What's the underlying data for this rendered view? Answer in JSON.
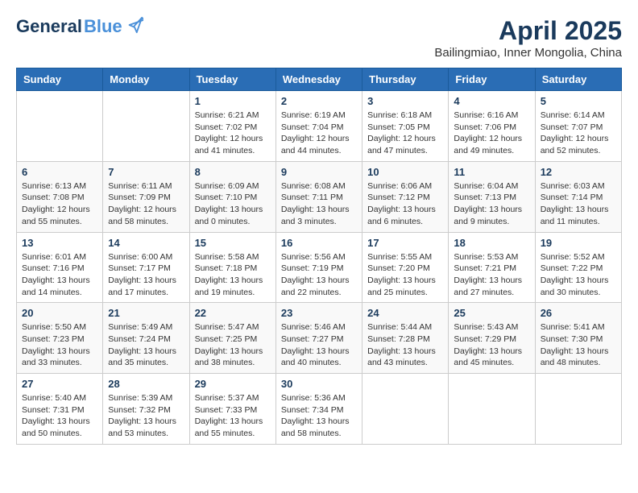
{
  "header": {
    "logo_general": "General",
    "logo_blue": "Blue",
    "month_year": "April 2025",
    "location": "Bailingmiao, Inner Mongolia, China"
  },
  "weekdays": [
    "Sunday",
    "Monday",
    "Tuesday",
    "Wednesday",
    "Thursday",
    "Friday",
    "Saturday"
  ],
  "weeks": [
    [
      {
        "day": "",
        "info": ""
      },
      {
        "day": "",
        "info": ""
      },
      {
        "day": "1",
        "info": "Sunrise: 6:21 AM\nSunset: 7:02 PM\nDaylight: 12 hours and 41 minutes."
      },
      {
        "day": "2",
        "info": "Sunrise: 6:19 AM\nSunset: 7:04 PM\nDaylight: 12 hours and 44 minutes."
      },
      {
        "day": "3",
        "info": "Sunrise: 6:18 AM\nSunset: 7:05 PM\nDaylight: 12 hours and 47 minutes."
      },
      {
        "day": "4",
        "info": "Sunrise: 6:16 AM\nSunset: 7:06 PM\nDaylight: 12 hours and 49 minutes."
      },
      {
        "day": "5",
        "info": "Sunrise: 6:14 AM\nSunset: 7:07 PM\nDaylight: 12 hours and 52 minutes."
      }
    ],
    [
      {
        "day": "6",
        "info": "Sunrise: 6:13 AM\nSunset: 7:08 PM\nDaylight: 12 hours and 55 minutes."
      },
      {
        "day": "7",
        "info": "Sunrise: 6:11 AM\nSunset: 7:09 PM\nDaylight: 12 hours and 58 minutes."
      },
      {
        "day": "8",
        "info": "Sunrise: 6:09 AM\nSunset: 7:10 PM\nDaylight: 13 hours and 0 minutes."
      },
      {
        "day": "9",
        "info": "Sunrise: 6:08 AM\nSunset: 7:11 PM\nDaylight: 13 hours and 3 minutes."
      },
      {
        "day": "10",
        "info": "Sunrise: 6:06 AM\nSunset: 7:12 PM\nDaylight: 13 hours and 6 minutes."
      },
      {
        "day": "11",
        "info": "Sunrise: 6:04 AM\nSunset: 7:13 PM\nDaylight: 13 hours and 9 minutes."
      },
      {
        "day": "12",
        "info": "Sunrise: 6:03 AM\nSunset: 7:14 PM\nDaylight: 13 hours and 11 minutes."
      }
    ],
    [
      {
        "day": "13",
        "info": "Sunrise: 6:01 AM\nSunset: 7:16 PM\nDaylight: 13 hours and 14 minutes."
      },
      {
        "day": "14",
        "info": "Sunrise: 6:00 AM\nSunset: 7:17 PM\nDaylight: 13 hours and 17 minutes."
      },
      {
        "day": "15",
        "info": "Sunrise: 5:58 AM\nSunset: 7:18 PM\nDaylight: 13 hours and 19 minutes."
      },
      {
        "day": "16",
        "info": "Sunrise: 5:56 AM\nSunset: 7:19 PM\nDaylight: 13 hours and 22 minutes."
      },
      {
        "day": "17",
        "info": "Sunrise: 5:55 AM\nSunset: 7:20 PM\nDaylight: 13 hours and 25 minutes."
      },
      {
        "day": "18",
        "info": "Sunrise: 5:53 AM\nSunset: 7:21 PM\nDaylight: 13 hours and 27 minutes."
      },
      {
        "day": "19",
        "info": "Sunrise: 5:52 AM\nSunset: 7:22 PM\nDaylight: 13 hours and 30 minutes."
      }
    ],
    [
      {
        "day": "20",
        "info": "Sunrise: 5:50 AM\nSunset: 7:23 PM\nDaylight: 13 hours and 33 minutes."
      },
      {
        "day": "21",
        "info": "Sunrise: 5:49 AM\nSunset: 7:24 PM\nDaylight: 13 hours and 35 minutes."
      },
      {
        "day": "22",
        "info": "Sunrise: 5:47 AM\nSunset: 7:25 PM\nDaylight: 13 hours and 38 minutes."
      },
      {
        "day": "23",
        "info": "Sunrise: 5:46 AM\nSunset: 7:27 PM\nDaylight: 13 hours and 40 minutes."
      },
      {
        "day": "24",
        "info": "Sunrise: 5:44 AM\nSunset: 7:28 PM\nDaylight: 13 hours and 43 minutes."
      },
      {
        "day": "25",
        "info": "Sunrise: 5:43 AM\nSunset: 7:29 PM\nDaylight: 13 hours and 45 minutes."
      },
      {
        "day": "26",
        "info": "Sunrise: 5:41 AM\nSunset: 7:30 PM\nDaylight: 13 hours and 48 minutes."
      }
    ],
    [
      {
        "day": "27",
        "info": "Sunrise: 5:40 AM\nSunset: 7:31 PM\nDaylight: 13 hours and 50 minutes."
      },
      {
        "day": "28",
        "info": "Sunrise: 5:39 AM\nSunset: 7:32 PM\nDaylight: 13 hours and 53 minutes."
      },
      {
        "day": "29",
        "info": "Sunrise: 5:37 AM\nSunset: 7:33 PM\nDaylight: 13 hours and 55 minutes."
      },
      {
        "day": "30",
        "info": "Sunrise: 5:36 AM\nSunset: 7:34 PM\nDaylight: 13 hours and 58 minutes."
      },
      {
        "day": "",
        "info": ""
      },
      {
        "day": "",
        "info": ""
      },
      {
        "day": "",
        "info": ""
      }
    ]
  ]
}
